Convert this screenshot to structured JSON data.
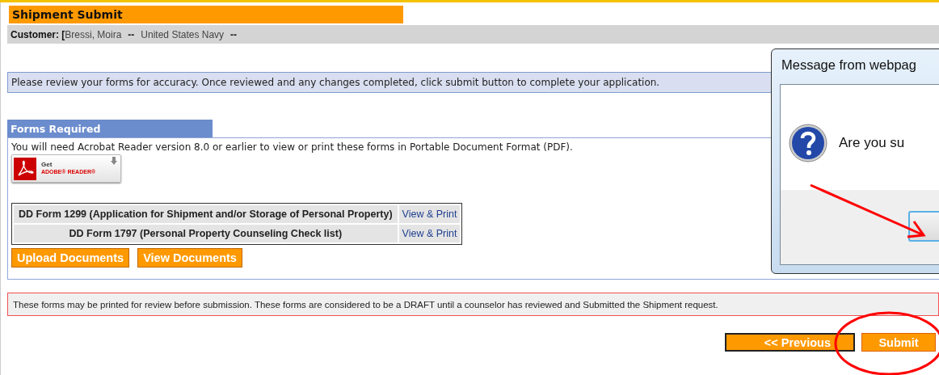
{
  "page_title": "Shipment Submit",
  "customer": {
    "label": "Customer: [",
    "name": "Bressi, Moira",
    "sep1": "--",
    "branch": "United States Navy",
    "sep2": "--"
  },
  "info": "Please review your forms for accuracy. Once reviewed and any changes completed, click submit button to complete your application.",
  "forms_section": {
    "heading": "Forms Required",
    "note": "You will need Acrobat Reader version 8.0 or earlier to view or print these forms in Portable Document Format (PDF).",
    "adobe_badge": {
      "get": "Get",
      "brand": "ADOBE® READER®"
    },
    "forms": [
      {
        "name": "DD Form 1299 (Application for Shipment and/or Storage of Personal Property)",
        "action": "View & Print"
      },
      {
        "name": "DD Form 1797 (Personal Property Counseling Check list)",
        "action": "View & Print"
      }
    ],
    "buttons": [
      "Upload Documents",
      "View Documents"
    ]
  },
  "notice": "These forms may be printed for review before submission. These forms are considered to be a DRAFT until a counselor has reviewed and Submitted the Shipment request.",
  "nav_buttons": [
    {
      "label": "<< Previous",
      "kind": "secondary"
    },
    {
      "label": "Submit",
      "kind": "primary"
    }
  ],
  "dialog": {
    "title": "Message from webpag",
    "message": "Are you su"
  }
}
